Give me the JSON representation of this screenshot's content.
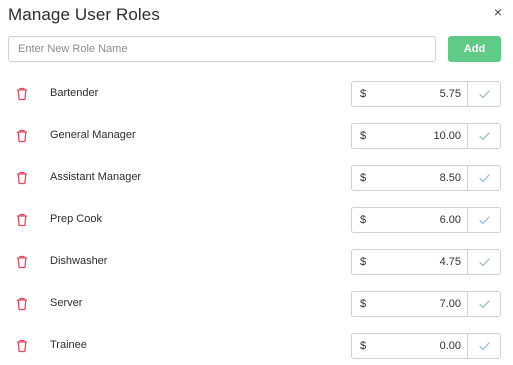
{
  "modal": {
    "title": "Manage User Roles",
    "close_glyph": "×"
  },
  "new_role": {
    "placeholder": "Enter New Role Name",
    "value": "",
    "add_label": "Add"
  },
  "colors": {
    "add_button": "#5fcb87",
    "trash_icon": "#e14b62",
    "check_icon": "#8fb8e0"
  },
  "currency_symbol": "$",
  "roles": [
    {
      "name": "Bartender",
      "rate": "5.75"
    },
    {
      "name": "General Manager",
      "rate": "10.00"
    },
    {
      "name": "Assistant Manager",
      "rate": "8.50"
    },
    {
      "name": "Prep Cook",
      "rate": "6.00"
    },
    {
      "name": "Dishwasher",
      "rate": "4.75"
    },
    {
      "name": "Server",
      "rate": "7.00"
    },
    {
      "name": "Trainee",
      "rate": "0.00"
    }
  ],
  "icons": {
    "delete": "trash-icon",
    "confirm": "check-icon",
    "close": "close-icon"
  }
}
